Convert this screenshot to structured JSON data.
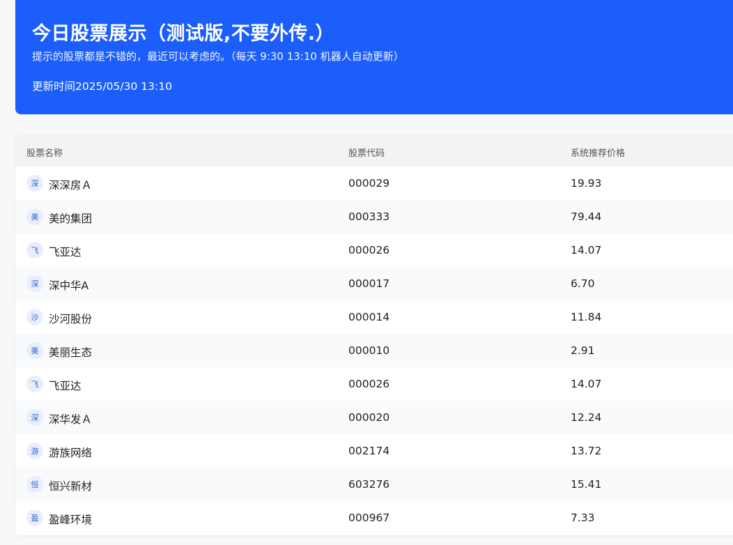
{
  "header": {
    "title": "今日股票展示（测试版,不要外传.）",
    "subtitle": "提示的股票都是不错的，最近可以考虑的。（每天 9:30 13:10 机器人自动更新）",
    "updated": "更新时间2025/05/30 13:10"
  },
  "table": {
    "columns": [
      "股票名称",
      "股票代码",
      "系统推荐价格"
    ],
    "rows": [
      {
        "avatar": "深",
        "name": "深深房Ａ",
        "code": "000029",
        "price": "19.93"
      },
      {
        "avatar": "美",
        "name": "美的集团",
        "code": "000333",
        "price": "79.44"
      },
      {
        "avatar": "飞",
        "name": "飞亚达",
        "code": "000026",
        "price": "14.07"
      },
      {
        "avatar": "深",
        "name": "深中华A",
        "code": "000017",
        "price": "6.70"
      },
      {
        "avatar": "沙",
        "name": "沙河股份",
        "code": "000014",
        "price": "11.84"
      },
      {
        "avatar": "美",
        "name": "美丽生态",
        "code": "000010",
        "price": "2.91"
      },
      {
        "avatar": "飞",
        "name": "飞亚达",
        "code": "000026",
        "price": "14.07"
      },
      {
        "avatar": "深",
        "name": "深华发Ａ",
        "code": "000020",
        "price": "12.24"
      },
      {
        "avatar": "游",
        "name": "游族网络",
        "code": "002174",
        "price": "13.72"
      },
      {
        "avatar": "恒",
        "name": "恒兴新材",
        "code": "603276",
        "price": "15.41"
      },
      {
        "avatar": "盈",
        "name": "盈峰环境",
        "code": "000967",
        "price": "7.33"
      }
    ]
  },
  "colors": {
    "header_bg": "#1b5efb",
    "avatar_bg": "#e8eefb",
    "avatar_text": "#2f63d6"
  }
}
